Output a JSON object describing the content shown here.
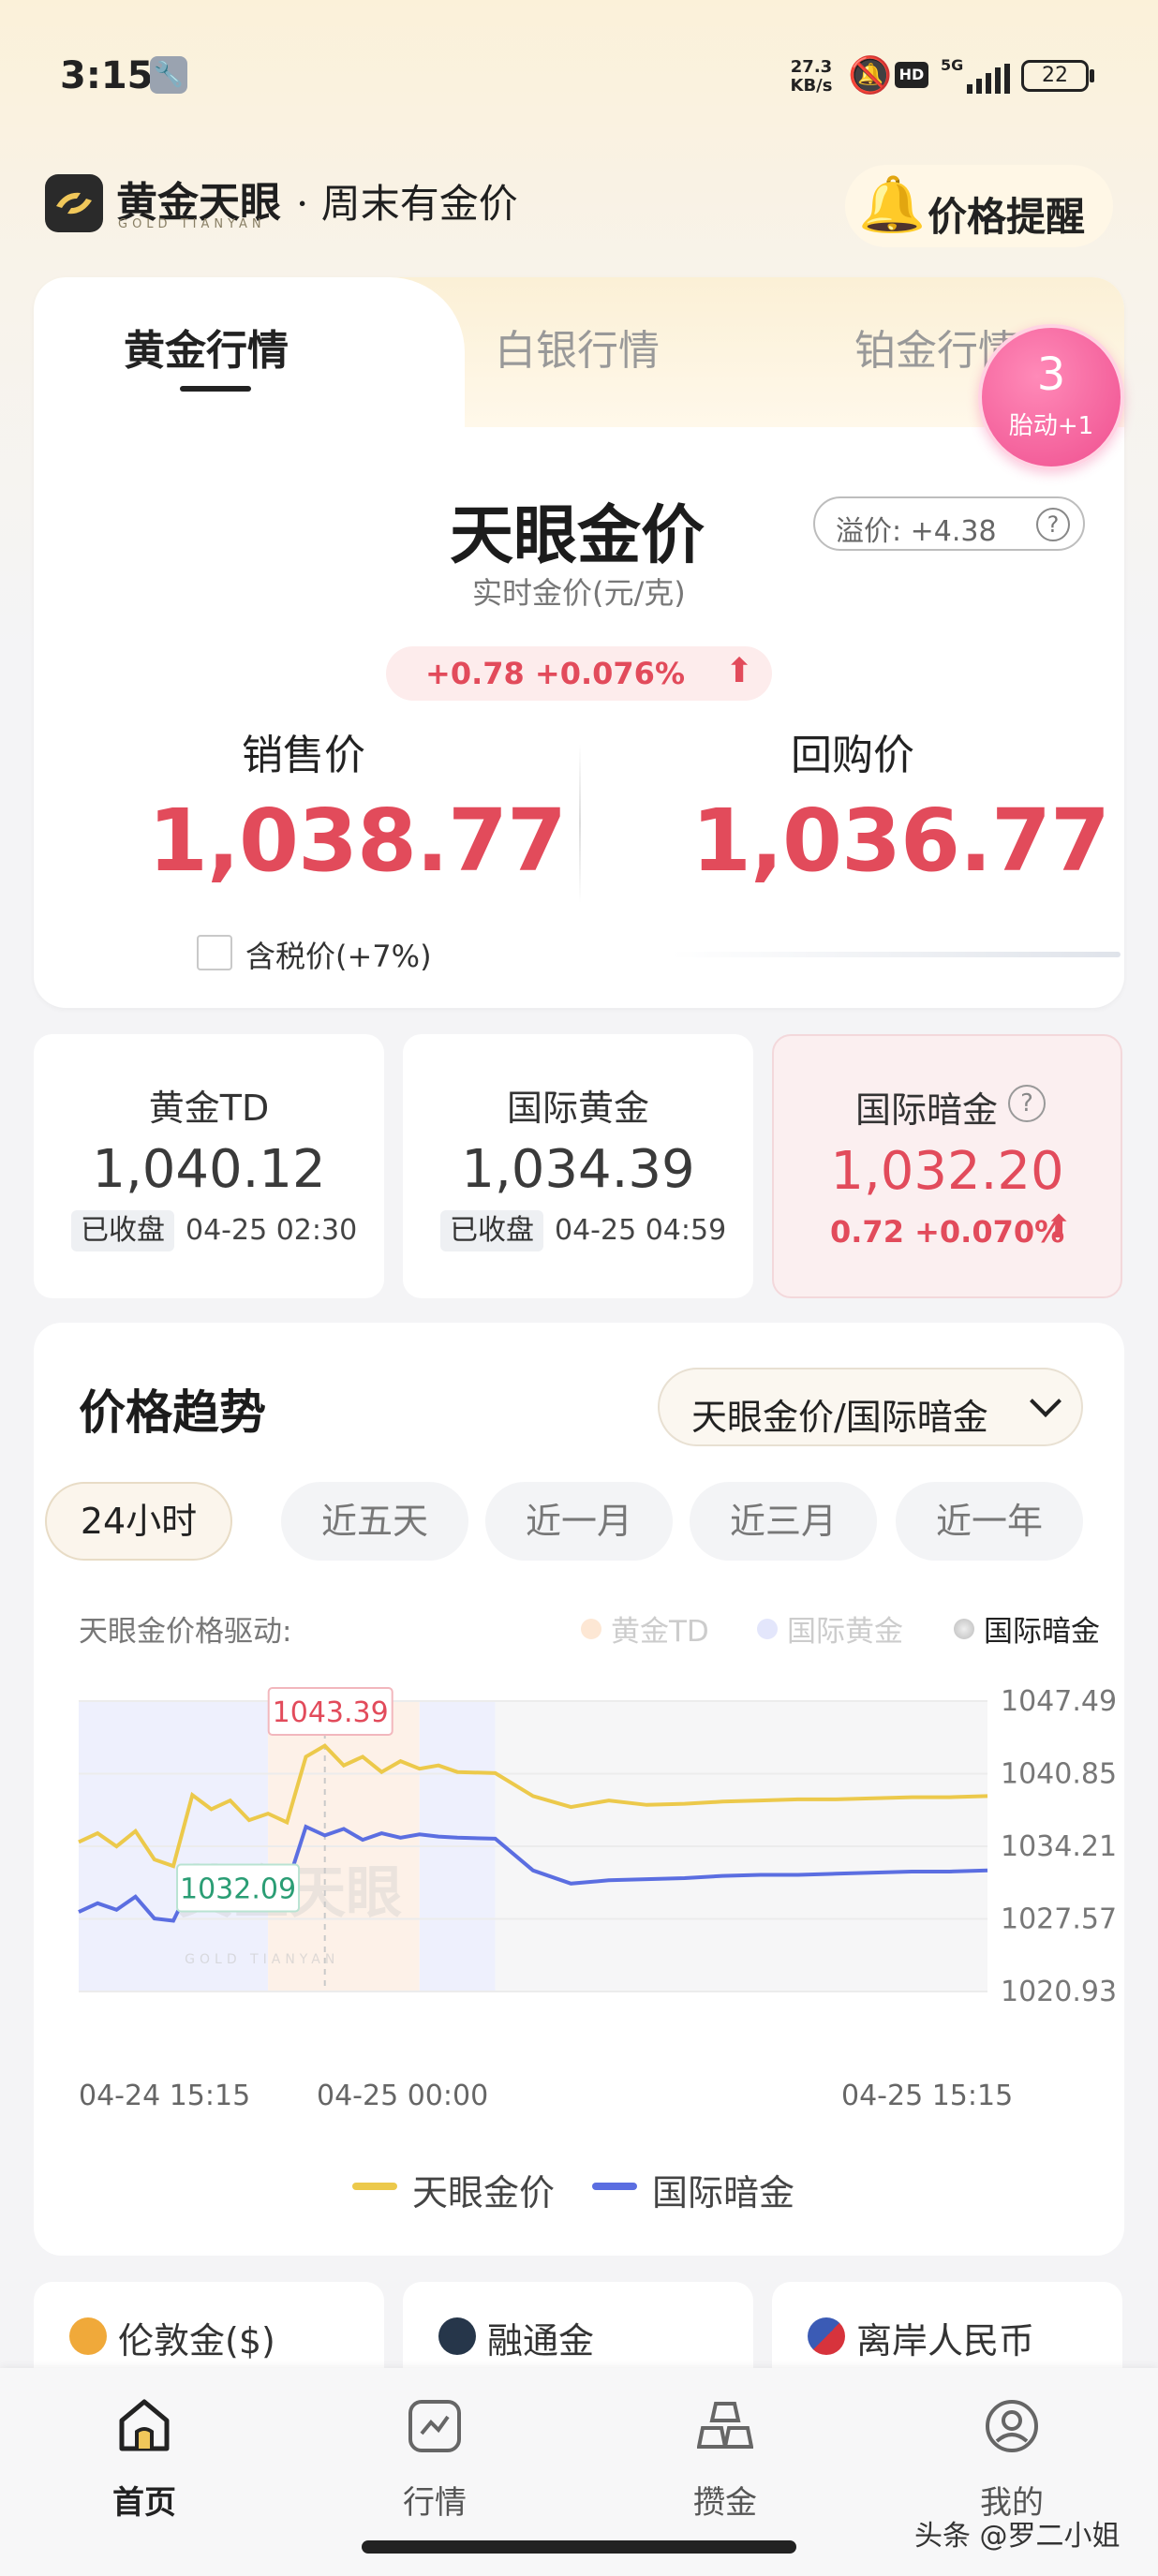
{
  "status": {
    "time": "3:15",
    "net_speed_top": "27.3",
    "net_speed_bottom": "KB/s",
    "hd": "HD",
    "network": "5G",
    "battery": "22"
  },
  "header": {
    "brand": "黄金天眼",
    "brand_en": "GOLD TIANYAN",
    "slogan": "· 周末有金价",
    "alert_label": "价格提醒"
  },
  "tabs": [
    {
      "label": "黄金行情",
      "active": true
    },
    {
      "label": "白银行情",
      "active": false
    },
    {
      "label": "铂金行情",
      "active": false
    }
  ],
  "bubble": {
    "count": "3",
    "text": "胎动+1"
  },
  "price_card": {
    "title": "天眼金价",
    "subtitle": "实时金价(元/克)",
    "premium": "溢价: +4.38",
    "premium_help": "?",
    "change": "+0.78 +0.076%",
    "sale_label": "销售价",
    "sale_value": "1,038.77",
    "buy_label": "回购价",
    "buy_value": "1,036.77",
    "tax_label": "含税价(+7%)",
    "tax_checked": false
  },
  "mini_cards": [
    {
      "name": "黄金TD",
      "price": "1,040.12",
      "tag": "已收盘",
      "time": "04-25 02:30"
    },
    {
      "name": "国际黄金",
      "price": "1,034.39",
      "tag": "已收盘",
      "time": "04-25 04:59"
    },
    {
      "name": "国际暗金",
      "price": "1,032.20",
      "change": "0.72 +0.070%",
      "help": "?"
    }
  ],
  "trend": {
    "title": "价格趋势",
    "selector": "天眼金价/国际暗金",
    "ranges": [
      {
        "label": "24小时",
        "active": true
      },
      {
        "label": "近五天",
        "active": false
      },
      {
        "label": "近一月",
        "active": false
      },
      {
        "label": "近三月",
        "active": false
      },
      {
        "label": "近一年",
        "active": false
      }
    ],
    "drive_label": "天眼金价格驱动:",
    "drive_legend": [
      "黄金TD",
      "国际黄金",
      "国际暗金"
    ],
    "max_marker": "1043.39",
    "min_marker": "1032.09",
    "watermark": "黄金天眼",
    "watermark_en": "GOLD TIANYAN",
    "bottom_legend": [
      "天眼金价",
      "国际暗金"
    ]
  },
  "chart_data": {
    "type": "line",
    "title": "",
    "xlabel": "",
    "ylabel": "",
    "x_tick_labels": [
      "04-24 15:15",
      "04-25 00:00",
      "04-25 15:15"
    ],
    "y_ticks": [
      1047.49,
      1040.85,
      1034.21,
      1027.57,
      1020.93
    ],
    "ylim": [
      1020.93,
      1047.49
    ],
    "x": [
      0,
      0.5,
      1,
      1.5,
      2,
      2.5,
      3,
      3.5,
      4,
      4.5,
      5,
      5.5,
      6,
      6.5,
      7,
      7.5,
      8,
      8.5,
      9,
      9.5,
      10,
      11,
      12,
      13,
      14,
      15,
      16,
      17,
      18,
      19,
      20,
      21,
      22,
      23,
      24
    ],
    "x_unit": "hours since 04-24 15:15",
    "series": [
      {
        "name": "天眼金价",
        "color": "#ecc94b",
        "values": [
          1034.6,
          1035.4,
          1034.2,
          1035.6,
          1033.0,
          1032.4,
          1038.9,
          1037.6,
          1038.4,
          1036.6,
          1037.2,
          1036.4,
          1042.4,
          1043.4,
          1041.6,
          1042.4,
          1041.0,
          1042.0,
          1041.3,
          1041.6,
          1041.0,
          1040.9,
          1038.8,
          1037.8,
          1038.4,
          1038.0,
          1038.1,
          1038.3,
          1038.4,
          1038.5,
          1038.5,
          1038.6,
          1038.7,
          1038.7,
          1038.8
        ]
      },
      {
        "name": "国际暗金",
        "color": "#5b6ee1",
        "values": [
          1028.2,
          1029.0,
          1028.4,
          1029.6,
          1027.6,
          1027.4,
          1031.0,
          1030.2,
          1031.6,
          1030.8,
          1031.4,
          1030.6,
          1036.0,
          1035.2,
          1035.8,
          1034.8,
          1035.4,
          1035.0,
          1035.3,
          1035.1,
          1035.0,
          1034.9,
          1032.0,
          1030.8,
          1031.1,
          1031.2,
          1031.3,
          1031.5,
          1031.6,
          1031.6,
          1031.7,
          1031.8,
          1031.9,
          1031.9,
          1032.0
        ]
      }
    ],
    "grid": true,
    "legend": "bottom"
  },
  "bottom_cards": [
    {
      "label": "伦敦金($)",
      "icon": "coin-icon",
      "color": "#f0a93a"
    },
    {
      "label": "融通金",
      "icon": "rongtong-logo-icon",
      "color": "#26364a"
    },
    {
      "label": "离岸人民币",
      "icon": "us-flag-icon",
      "color": "#d7333c"
    }
  ],
  "nav": [
    {
      "label": "首页",
      "icon": "home-icon",
      "active": true
    },
    {
      "label": "行情",
      "icon": "chart-icon",
      "active": false
    },
    {
      "label": "攒金",
      "icon": "gold-bars-icon",
      "active": false
    },
    {
      "label": "我的",
      "icon": "profile-icon",
      "active": false
    }
  ],
  "watermark": "头条 @罗二小姐",
  "colors": {
    "accent_red": "#e24b5b",
    "gold_line": "#ecc94b",
    "blue_line": "#5b6ee1",
    "bubble_pink": "#ef4f8f"
  }
}
